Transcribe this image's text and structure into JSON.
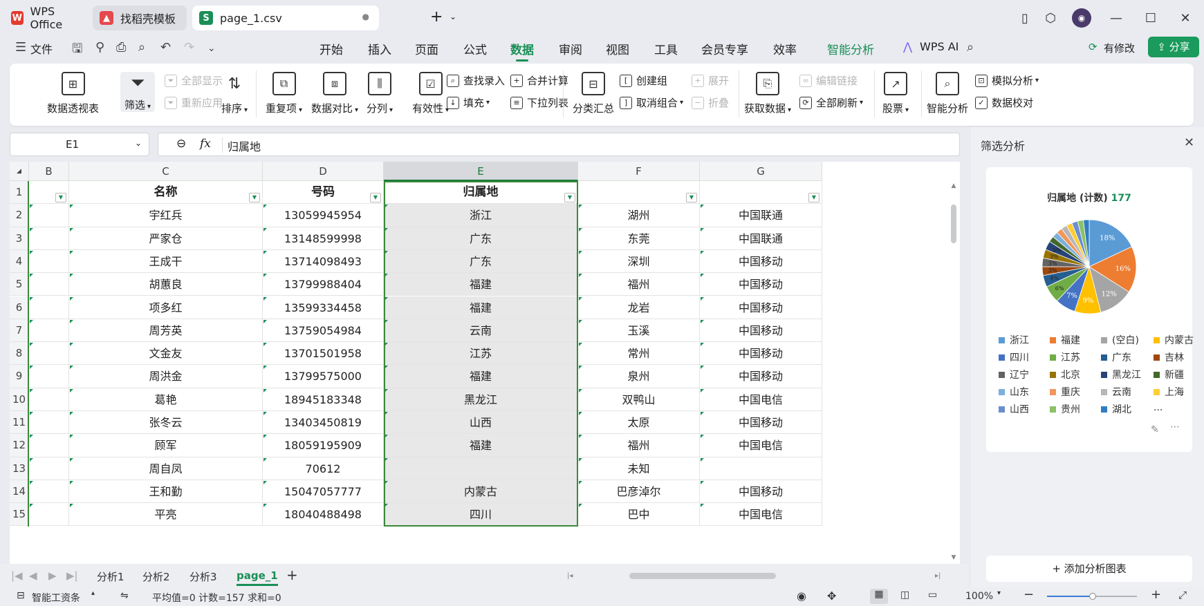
{
  "tabs": [
    {
      "label": "WPS Office",
      "icon": "wps-logo-icon"
    },
    {
      "label": "找稻壳模板",
      "icon": "docer-icon"
    },
    {
      "label": "page_1.csv",
      "icon": "sheet-icon"
    }
  ],
  "menu": {
    "file": "文件",
    "items": [
      "开始",
      "插入",
      "页面",
      "公式",
      "数据",
      "审阅",
      "视图",
      "工具",
      "会员专享",
      "效率"
    ],
    "active": "数据",
    "smart": "智能分析",
    "wps_ai": "WPS AI",
    "modified": "有修改",
    "share": "分享"
  },
  "ribbon": {
    "pivot": "数据透视表",
    "filter": "筛选",
    "show_all": "全部显示",
    "reapply": "重新应用",
    "sort": "排序",
    "duplicates": "重复项",
    "compare": "数据对比",
    "split": "分列",
    "validity": "有效性",
    "lookup": "查找录入",
    "fill": "填充",
    "consolidate": "合并计算",
    "dropdown": "下拉列表",
    "subtotal": "分类汇总",
    "group": "创建组",
    "ungroup": "取消组合",
    "expand": "展开",
    "collapse": "折叠",
    "get_data": "获取数据",
    "edit_links": "编辑链接",
    "refresh_all": "全部刷新",
    "stocks": "股票",
    "smart_analysis": "智能分析",
    "what_if": "模拟分析",
    "data_check": "数据校对"
  },
  "formula_bar": {
    "cell_ref": "E1",
    "content": "归属地"
  },
  "columns": [
    "B",
    "C",
    "D",
    "E",
    "F",
    "G"
  ],
  "rows": [
    {
      "n": "1",
      "b": "",
      "c": "名称",
      "d": "号码",
      "e": "归属地",
      "f": "",
      "g": ""
    },
    {
      "n": "2",
      "b": "",
      "c": "宇红兵",
      "d": "13059945954",
      "e": "浙江",
      "f": "湖州",
      "g": "中国联通"
    },
    {
      "n": "3",
      "b": "",
      "c": "严家仓",
      "d": "13148599998",
      "e": "广东",
      "f": "东莞",
      "g": "中国联通"
    },
    {
      "n": "4",
      "b": "",
      "c": "王成干",
      "d": "13714098493",
      "e": "广东",
      "f": "深圳",
      "g": "中国移动"
    },
    {
      "n": "5",
      "b": "",
      "c": "胡蕙良",
      "d": "13799988404",
      "e": "福建",
      "f": "福州",
      "g": "中国移动"
    },
    {
      "n": "6",
      "b": "",
      "c": "项多红",
      "d": "13599334458",
      "e": "福建",
      "f": "龙岩",
      "g": "中国移动"
    },
    {
      "n": "7",
      "b": "",
      "c": "周芳英",
      "d": "13759054984",
      "e": "云南",
      "f": "玉溪",
      "g": "中国移动"
    },
    {
      "n": "8",
      "b": "",
      "c": "文金友",
      "d": "13701501958",
      "e": "江苏",
      "f": "常州",
      "g": "中国移动"
    },
    {
      "n": "9",
      "b": "",
      "c": "周洪金",
      "d": "13799575000",
      "e": "福建",
      "f": "泉州",
      "g": "中国移动"
    },
    {
      "n": "10",
      "b": "",
      "c": "葛艳",
      "d": "18945183348",
      "e": "黑龙江",
      "f": "双鸭山",
      "g": "中国电信"
    },
    {
      "n": "11",
      "b": "",
      "c": "张冬云",
      "d": "13403450819",
      "e": "山西",
      "f": "太原",
      "g": "中国移动"
    },
    {
      "n": "12",
      "b": "",
      "c": "顾军",
      "d": "18059195909",
      "e": "福建",
      "f": "福州",
      "g": "中国电信"
    },
    {
      "n": "13",
      "b": "",
      "c": "周自凤",
      "d": "70612",
      "e": "",
      "f": "未知",
      "g": ""
    },
    {
      "n": "14",
      "b": "",
      "c": "王和勤",
      "d": "15047057777",
      "e": "内蒙古",
      "f": "巴彦淖尔",
      "g": "中国移动"
    },
    {
      "n": "15",
      "b": "",
      "c": "平亮",
      "d": "18040488498",
      "e": "四川",
      "f": "巴中",
      "g": "中国电信"
    }
  ],
  "sheets": [
    "分析1",
    "分析2",
    "分析3",
    "page_1"
  ],
  "active_sheet": "page_1",
  "status": {
    "tool": "智能工资条",
    "summary": "平均值=0  计数=157  求和=0",
    "zoom": "100%"
  },
  "panel": {
    "title": "筛选分析",
    "chart_title": "归属地 (计数)",
    "chart_total": "177",
    "add_chart": "添加分析图表",
    "more": "..."
  },
  "chart_data": {
    "type": "pie",
    "title": "归属地 (计数) 177",
    "total": 177,
    "labels": [
      "浙江",
      "福建",
      "(空白)",
      "内蒙古",
      "四川",
      "江苏",
      "广东",
      "吉林",
      "辽宁",
      "北京",
      "黑龙江",
      "新疆",
      "山东",
      "重庆",
      "云南",
      "上海",
      "山西",
      "贵州",
      "湖北"
    ],
    "colors": [
      "#5b9bd5",
      "#ed7d31",
      "#a5a5a5",
      "#ffc000",
      "#4472c4",
      "#70ad47",
      "#255e91",
      "#9e480e",
      "#636363",
      "#997300",
      "#264478",
      "#43682b",
      "#7cafdd",
      "#f1975a",
      "#b7b7b7",
      "#ffcd33",
      "#698ed0",
      "#8cc168",
      "#327dc2"
    ],
    "values": [
      18,
      16,
      12,
      9,
      7,
      6,
      4,
      3,
      3,
      3,
      3,
      2,
      2,
      2,
      2,
      2,
      2,
      2,
      2
    ],
    "data_labels": [
      "18%",
      "16%",
      "12%",
      "9%",
      "7%",
      "6%",
      "4%",
      "3%",
      "3%",
      "3%",
      "3%"
    ]
  }
}
